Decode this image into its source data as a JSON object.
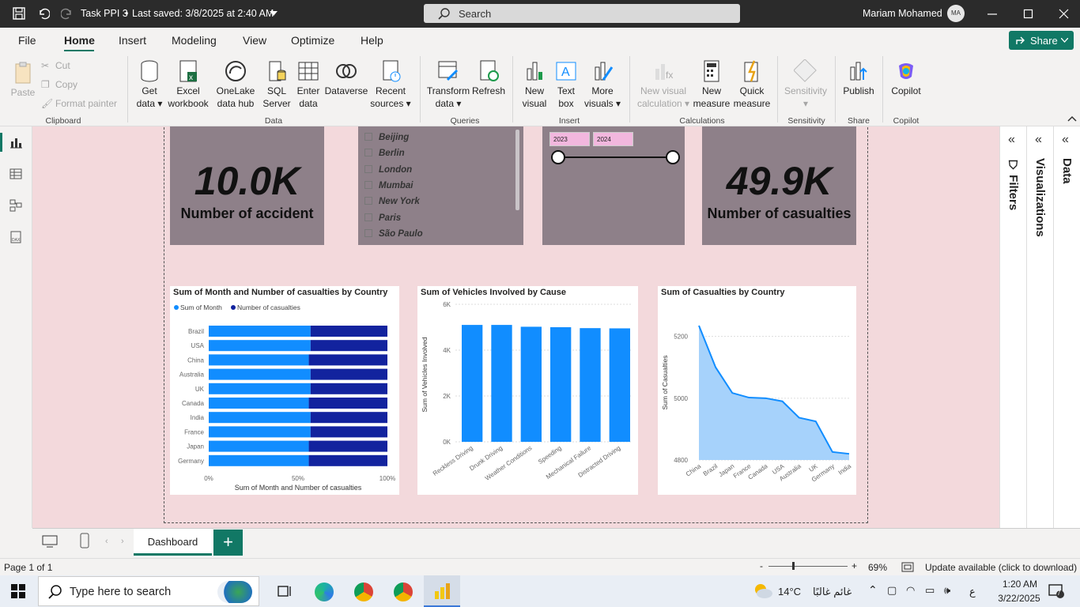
{
  "titlebar": {
    "file_title": "Task PPI 3",
    "saved": "Last saved: 3/8/2025 at 2:40 AM",
    "search": "Search",
    "user": "Mariam Mohamed",
    "avatar": "MA"
  },
  "menu": [
    "File",
    "Home",
    "Insert",
    "Modeling",
    "View",
    "Optimize",
    "Help"
  ],
  "share": "Share",
  "ribbon": {
    "clipboard": {
      "paste": "Paste",
      "cut": "Cut",
      "copy": "Copy",
      "format_painter": "Format painter",
      "group": "Clipboard"
    },
    "data": {
      "get_data": "Get data",
      "excel": "Excel workbook",
      "onelake": "OneLake data hub",
      "sql": "SQL Server",
      "enter": "Enter data",
      "dataverse": "Dataverse",
      "recent": "Recent sources",
      "group": "Data"
    },
    "queries": {
      "transform": "Transform data",
      "refresh": "Refresh",
      "group": "Queries"
    },
    "insert": {
      "new_visual": "New visual",
      "text_box": "Text box",
      "more_visuals": "More visuals",
      "group": "Insert"
    },
    "calculations": {
      "new_visual_calc": "New visual calculation",
      "new_measure": "New measure",
      "quick_measure": "Quick measure",
      "group": "Calculations"
    },
    "sensitivity": {
      "label": "Sensitivity",
      "group": "Sensitivity"
    },
    "share": {
      "publish": "Publish",
      "group": "Share"
    },
    "copilot": {
      "label": "Copilot",
      "group": "Copilot"
    }
  },
  "cards": {
    "accidents": {
      "value": "10.0K",
      "label": "Number of accident"
    },
    "casualties": {
      "value": "49.9K",
      "label": "Number of casualties"
    }
  },
  "slicer_cities": [
    "Beijing",
    "Berlin",
    "London",
    "Mumbai",
    "New York",
    "Paris",
    "São Paulo"
  ],
  "year_slider": {
    "from": "2023",
    "to": "2024"
  },
  "panes": {
    "filters": "Filters",
    "visualizations": "Visualizations",
    "data": "Data"
  },
  "tabs": {
    "dashboard": "Dashboard",
    "add": "+"
  },
  "status": {
    "page": "Page 1 of 1",
    "zoom": "69%",
    "update": "Update available (click to download)",
    "minus": "-",
    "plus": "+"
  },
  "taskbar": {
    "search": "Type here to search",
    "temp": "14°C",
    "weather": "غائم غالبًا",
    "lang": "ع",
    "time": "1:20 AM",
    "date": "3/22/2025",
    "notif": "7"
  },
  "chart_data": [
    {
      "type": "bar",
      "title": "Sum of Month and Number of casualties by Country",
      "orientation": "horizontal-100%-stacked",
      "categories": [
        "Brazil",
        "USA",
        "China",
        "Australia",
        "UK",
        "Canada",
        "India",
        "France",
        "Japan",
        "Germany"
      ],
      "series": [
        {
          "name": "Sum of Month",
          "values": [
            57,
            57,
            56,
            57,
            57,
            56,
            57,
            57,
            56,
            56
          ],
          "color": "#118dff"
        },
        {
          "name": "Number of casualties",
          "values": [
            43,
            43,
            44,
            43,
            43,
            44,
            43,
            43,
            44,
            44
          ],
          "color": "#12239e"
        }
      ],
      "xlabel": "Sum of Month and Number of casualties",
      "xticks": [
        "0%",
        "50%",
        "100%"
      ],
      "legend": "top-left"
    },
    {
      "type": "bar",
      "title": "Sum of Vehicles Involved by Cause",
      "categories": [
        "Reckless Driving",
        "Drunk Driving",
        "Weather Conditions",
        "Speeding",
        "Mechanical Failure",
        "Distracted Driving"
      ],
      "values": [
        5100,
        5100,
        5020,
        5000,
        4960,
        4950
      ],
      "ylabel": "Sum of Vehicles Involved",
      "yticks": [
        "0K",
        "2K",
        "4K",
        "6K"
      ],
      "ylim": [
        0,
        6000
      ],
      "color": "#118dff"
    },
    {
      "type": "area",
      "title": "Sum of Casualties by Country",
      "categories": [
        "China",
        "Brazil",
        "Japan",
        "France",
        "Canada",
        "USA",
        "Australia",
        "UK",
        "Germany",
        "India"
      ],
      "values": [
        5235,
        5100,
        5017,
        5002,
        5000,
        4990,
        4937,
        4925,
        4826,
        4820
      ],
      "ylabel": "Sum of Casualties",
      "yticks": [
        "4800",
        "5000",
        "5200"
      ],
      "ylim": [
        4800,
        5240
      ],
      "color": "#118dff"
    }
  ]
}
